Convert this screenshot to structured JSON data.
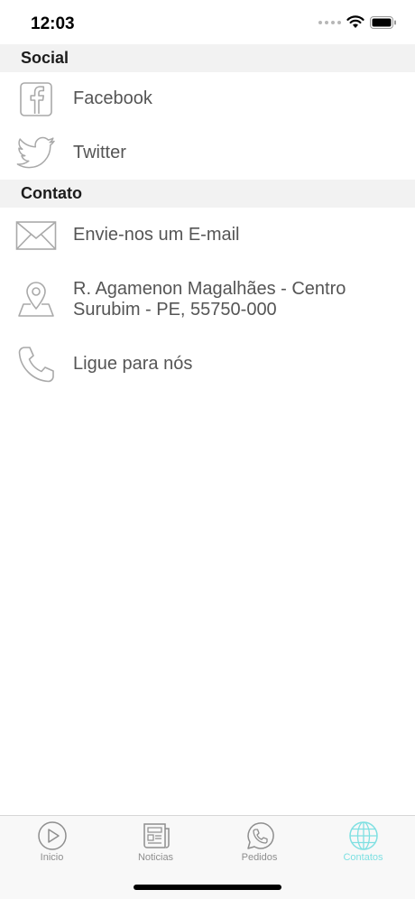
{
  "status_bar": {
    "time": "12:03"
  },
  "sections": {
    "social": {
      "title": "Social",
      "items": [
        {
          "label": "Facebook",
          "icon": "facebook-icon"
        },
        {
          "label": "Twitter",
          "icon": "twitter-icon"
        }
      ]
    },
    "contato": {
      "title": "Contato",
      "items": [
        {
          "label": "Envie-nos um E-mail",
          "icon": "mail-icon"
        },
        {
          "label_line1": "R. Agamenon Magalhães - Centro",
          "label_line2": "Surubim - PE, 55750-000",
          "icon": "map-pin-icon"
        },
        {
          "label": "Ligue para nós",
          "icon": "phone-icon"
        }
      ]
    }
  },
  "tab_bar": {
    "tabs": [
      {
        "label": "Inicio",
        "icon": "play-circle-icon"
      },
      {
        "label": "Noticias",
        "icon": "newspaper-icon"
      },
      {
        "label": "Pedidos",
        "icon": "whatsapp-icon"
      },
      {
        "label": "Contatos",
        "icon": "globe-icon"
      }
    ],
    "active_index": 3
  },
  "colors": {
    "accent": "#7fe0e2",
    "icon_gray": "#a9a9a9",
    "text_gray": "#555555",
    "header_bg": "#f2f2f2"
  }
}
